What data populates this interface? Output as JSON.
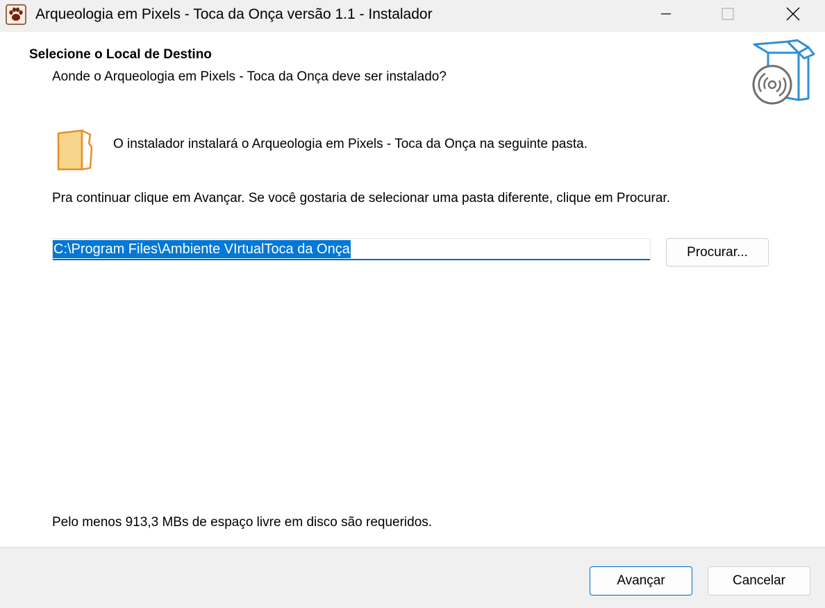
{
  "window": {
    "title": "Arqueologia em Pixels - Toca da Onça versão 1.1 - Instalador",
    "icon": "paw-icon",
    "controls": [
      "minimize-icon",
      "maximize-icon",
      "close-icon"
    ]
  },
  "header": {
    "title": "Selecione o Local de Destino",
    "subtitle": "Aonde o Arqueologia em Pixels - Toca da Onça deve ser instalado?",
    "image": "installer-box-icon"
  },
  "main": {
    "folder_icon": "folder-icon",
    "info": "O instalador instalará o Arqueologia em Pixels - Toca da Onça na seguinte pasta.",
    "instructions": "Pra continuar clique em Avançar. Se você gostaria de selecionar uma pasta diferente, clique em Procurar.",
    "path_value": "C:\\Program Files\\Ambiente VIrtualToca da Onça",
    "browse_label": "Procurar...",
    "disk_space": "Pelo menos 913,3 MBs de espaço livre em disco são requeridos."
  },
  "footer": {
    "next_label": "Avançar",
    "cancel_label": "Cancelar"
  },
  "colors": {
    "accent": "#0067c0",
    "selection": "#0078d7",
    "folder": "#f6d68a",
    "folder_outline": "#e88d2c",
    "box_blue": "#2f8fd8",
    "titlebar_bg": "#f0f0f0",
    "content_bg": "#ffffff"
  }
}
